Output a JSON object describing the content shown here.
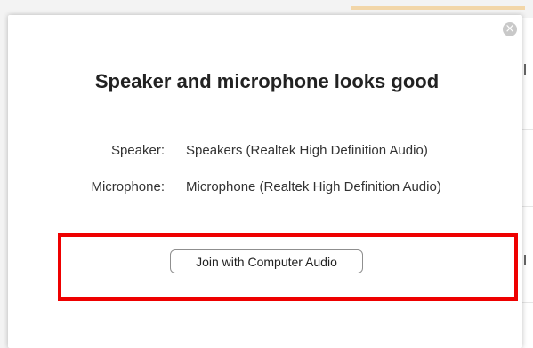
{
  "dialog": {
    "title": "Speaker and microphone looks good",
    "close_glyph": "×",
    "close_icon": "close-icon",
    "devices": {
      "speaker": {
        "label": "Speaker:",
        "value": "Speakers (Realtek High Definition Audio)"
      },
      "microphone": {
        "label": "Microphone:",
        "value": "Microphone (Realtek High Definition Audio)"
      }
    },
    "join_button_label": "Join with Computer Audio"
  },
  "colors": {
    "highlight": "#ee0000",
    "background_accent": "#f2d6a8"
  }
}
